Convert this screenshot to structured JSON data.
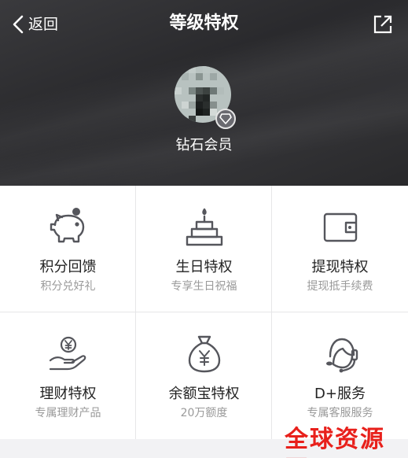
{
  "nav": {
    "back_label": "返回",
    "title": "等级特权"
  },
  "member": {
    "level_label": "钻石会员"
  },
  "privileges": [
    {
      "name": "积分回馈",
      "desc": "积分兑好礼",
      "icon": "piggy-bank-icon"
    },
    {
      "name": "生日特权",
      "desc": "专享生日祝福",
      "icon": "birthday-cake-icon"
    },
    {
      "name": "提现特权",
      "desc": "提现抵手续费",
      "icon": "wallet-icon"
    },
    {
      "name": "理财特权",
      "desc": "专属理财产品",
      "icon": "hand-coin-icon"
    },
    {
      "name": "余额宝特权",
      "desc": "20万额度",
      "icon": "money-bag-icon"
    },
    {
      "name": "D+服务",
      "desc": "专属客服服务",
      "icon": "customer-service-icon"
    }
  ],
  "watermark": "全球资源网",
  "colors": {
    "header_bg": "#2e2e31",
    "icon_stroke": "#55565c",
    "watermark": "#e8201b"
  }
}
